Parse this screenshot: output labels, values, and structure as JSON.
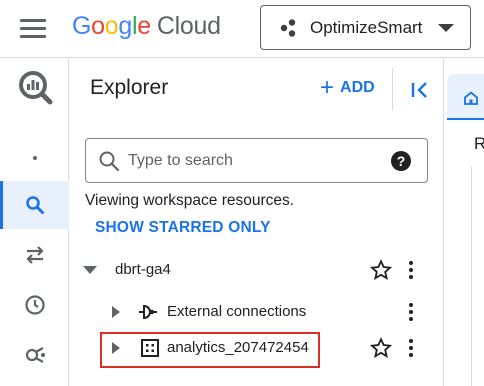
{
  "header": {
    "logo_google_letters": [
      "G",
      "o",
      "o",
      "g",
      "l",
      "e"
    ],
    "logo_product": "Cloud",
    "project_name": "OptimizeSmart",
    "colors": {
      "blue": "#4285f4",
      "red": "#ea4335",
      "yellow": "#fbbc05",
      "green": "#34a853"
    }
  },
  "rail": {
    "items": [
      {
        "icon": "more-dot-icon"
      },
      {
        "icon": "search-icon",
        "active": true
      },
      {
        "icon": "transfer-arrows-icon"
      },
      {
        "icon": "history-clock-icon"
      },
      {
        "icon": "analytics-hub-icon"
      }
    ]
  },
  "explorer": {
    "title": "Explorer",
    "add_label": "ADD",
    "search_placeholder": "Type to search",
    "viewing_text": "Viewing workspace resources.",
    "starred_link": "SHOW STARRED ONLY",
    "tree": {
      "project": {
        "label": "dbrt-ga4",
        "expanded": true
      },
      "children": [
        {
          "label": "External connections",
          "icon": "external-connection-icon"
        },
        {
          "label": "analytics_207472454",
          "icon": "dataset-icon",
          "highlighted": true
        }
      ]
    }
  },
  "right_panel": {
    "tab_icon": "home-icon",
    "heading_fragment": "R"
  },
  "accent_color": "#1a73e8",
  "highlight_color": "#d93025"
}
